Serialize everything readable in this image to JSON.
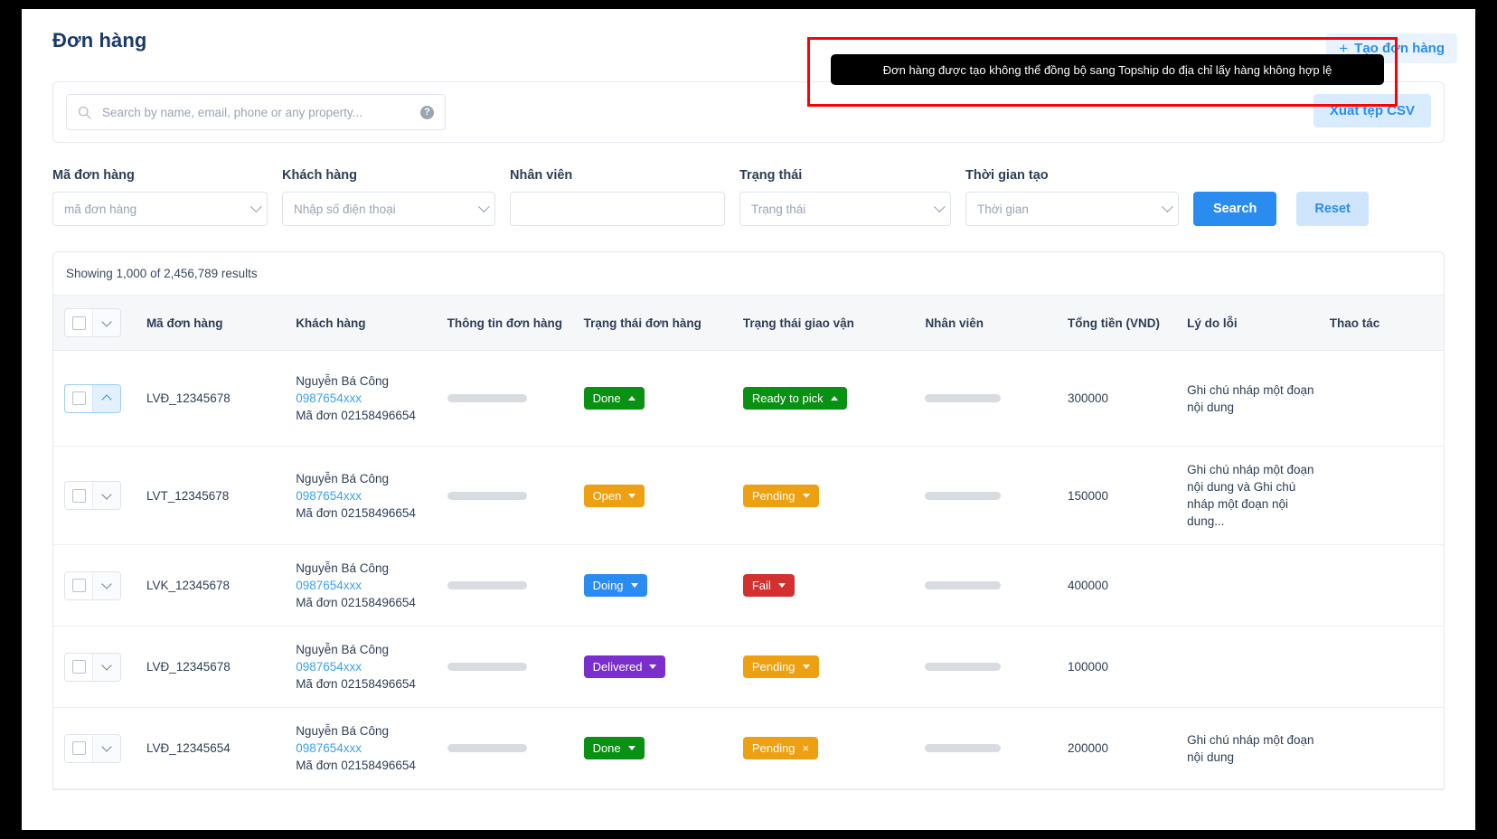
{
  "header": {
    "title": "Đơn hàng",
    "create_button": "Tạo đơn hàng",
    "create_plus": "+"
  },
  "tooltip": {
    "message": "Đơn hàng được tạo không thể đồng bộ sang Topship do địa chỉ lấy hàng không hợp lệ"
  },
  "search": {
    "placeholder": "Search by name, email, phone or any property...",
    "value": "",
    "help_icon": "?",
    "export_button": "Xuất tệp CSV"
  },
  "filters": {
    "order_code": {
      "label": "Mã đơn hàng",
      "placeholder": "mã đơn hàng",
      "value": ""
    },
    "customer": {
      "label": "Khách hàng",
      "placeholder": "Nhập số điện thoại",
      "value": ""
    },
    "staff": {
      "label": "Nhân viên",
      "placeholder": "",
      "value": ""
    },
    "status": {
      "label": "Trạng thái",
      "placeholder": "Trạng thái",
      "value": ""
    },
    "created_at": {
      "label": "Thời gian tạo",
      "placeholder": "Thời gian",
      "value": ""
    },
    "search_button": "Search",
    "reset_button": "Reset"
  },
  "table": {
    "results_text": "Showing 1,000 of 2,456,789 results",
    "columns": [
      "",
      "Mã đơn hàng",
      "Khách hàng",
      "Thông tin đơn hàng",
      "Trạng thái đơn hàng",
      "Trạng thái giao vận",
      "Nhân viên",
      "Tổng tiền (VND)",
      "Lý do lỗi",
      "Thao tác"
    ],
    "rows": [
      {
        "code": "LVĐ_12345678",
        "customer_name": "Nguyễn Bá Công",
        "customer_phone": "0987654xxx",
        "customer_sub": "Mã đơn 02158496654",
        "order_status": {
          "label": "Done",
          "color": "#099113",
          "caret": "up"
        },
        "ship_status": {
          "label": "Ready to pick",
          "color": "#099113",
          "caret": "up"
        },
        "total": "300000",
        "error": "Ghi chú nháp một đoạn nội dung",
        "selected": true
      },
      {
        "code": "LVT_12345678",
        "customer_name": "Nguyễn Bá Công",
        "customer_phone": "0987654xxx",
        "customer_sub": "Mã đơn 02158496654",
        "order_status": {
          "label": "Open",
          "color": "#eda011",
          "caret": "down"
        },
        "ship_status": {
          "label": "Pending",
          "color": "#eda011",
          "caret": "down"
        },
        "total": "150000",
        "error": "Ghi chú nháp một đoạn nội dung và Ghi chú nháp một đoạn nội dung...",
        "selected": false
      },
      {
        "code": "LVK_12345678",
        "customer_name": "Nguyễn Bá Công",
        "customer_phone": "0987654xxx",
        "customer_sub": "Mã đơn 02158496654",
        "order_status": {
          "label": "Doing",
          "color": "#2b8cf0",
          "caret": "down"
        },
        "ship_status": {
          "label": "Fail",
          "color": "#d33030",
          "caret": "down"
        },
        "total": "400000",
        "error": "",
        "selected": false
      },
      {
        "code": "LVĐ_12345678",
        "customer_name": "Nguyễn Bá Công",
        "customer_phone": "0987654xxx",
        "customer_sub": "Mã đơn 02158496654",
        "order_status": {
          "label": "Delivered",
          "color": "#7a2ecc",
          "caret": "down"
        },
        "ship_status": {
          "label": "Pending",
          "color": "#eda011",
          "caret": "down"
        },
        "total": "100000",
        "error": "",
        "selected": false
      },
      {
        "code": "LVĐ_12345654",
        "customer_name": "Nguyễn Bá Công",
        "customer_phone": "0987654xxx",
        "customer_sub": "Mã đơn 02158496654",
        "order_status": {
          "label": "Done",
          "color": "#099113",
          "caret": "down"
        },
        "ship_status": {
          "label": "Pending",
          "color": "#eda011",
          "caret": "x"
        },
        "total": "200000",
        "error": "Ghi chú nháp một đoạn nội dung",
        "selected": false
      }
    ]
  },
  "colors": {
    "accent": "#2b8cf0",
    "title": "#1b3a6b",
    "green": "#099113",
    "orange": "#eda011",
    "red": "#d33030",
    "purple": "#7a2ecc",
    "highlight_border": "#ff0000"
  }
}
